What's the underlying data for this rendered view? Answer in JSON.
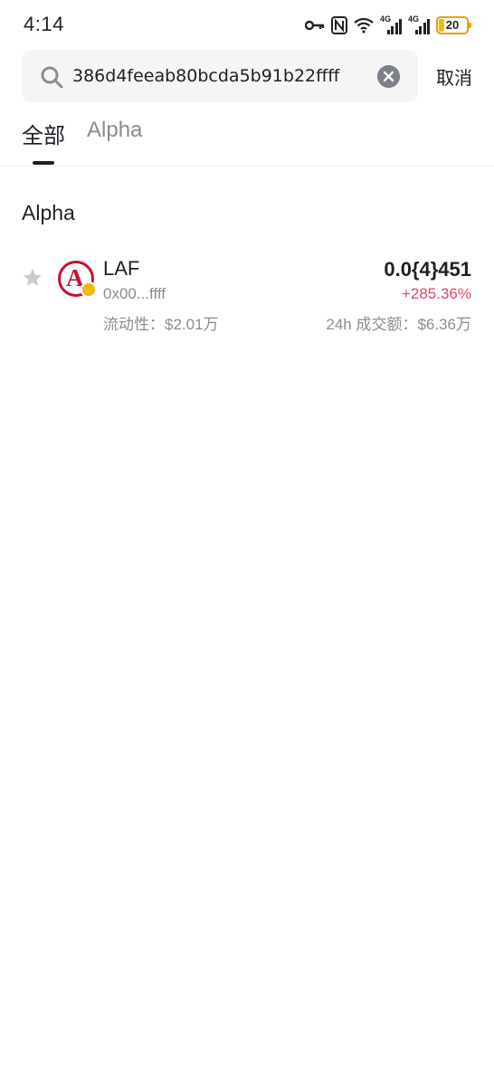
{
  "status_bar": {
    "time": "4:14",
    "network_1": "4G",
    "network_2": "4G",
    "battery": "20",
    "icons": [
      "key-icon",
      "nfc-icon",
      "wifi-icon",
      "signal-icon",
      "signal-icon",
      "battery-icon"
    ]
  },
  "search": {
    "value": "386d4feeab80bcda5b91b22ffff",
    "icon": "search-icon",
    "clear_icon": "clear-icon"
  },
  "cancel_label": "取消",
  "tabs": [
    {
      "label": "全部",
      "active": true
    },
    {
      "label": "Alpha",
      "active": false
    }
  ],
  "section": {
    "title": "Alpha"
  },
  "tokens": [
    {
      "symbol": "LAF",
      "address": "0x00...ffff",
      "liquidity": "流动性：$2.01万",
      "price": "0.0{4}451",
      "change": "+285.36%",
      "volume": "24h 成交额：$6.36万",
      "logo_letter": "A"
    }
  ],
  "colors": {
    "positive_change": "#e0485f",
    "accent": "#f0b90b",
    "logo_red": "#c8102e"
  }
}
